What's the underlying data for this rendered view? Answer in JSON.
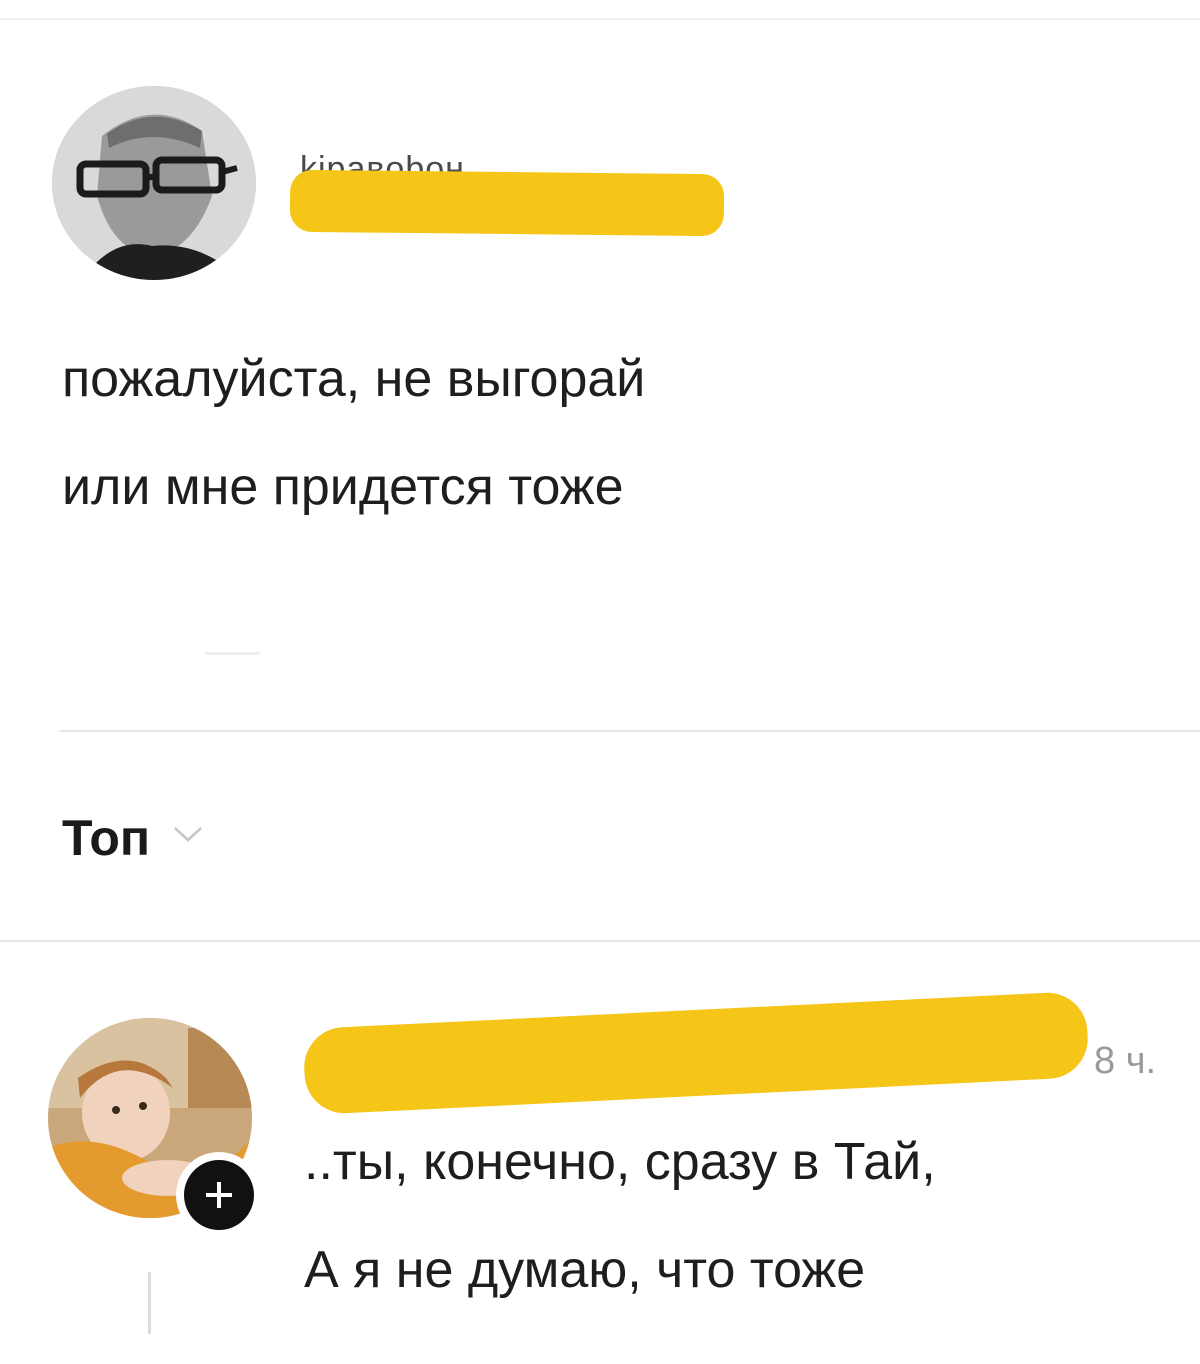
{
  "post": {
    "username_visible": "kiравobон",
    "text_lines": [
      "пожалуйста, не выгорай",
      "или мне придется тоже"
    ]
  },
  "sort": {
    "label": "Топ",
    "icon": "chevron-down-icon"
  },
  "comment": {
    "time": "8 ч.",
    "text_lines": [
      "..ты, конечно, сразу в Тай,",
      "А я не думаю, что тоже"
    ],
    "badge_icon": "plus-icon"
  },
  "colors": {
    "redaction": "#f5c518",
    "divider": "#e6e6e6",
    "text": "#1e1e1e",
    "muted": "#9a9a9a"
  }
}
